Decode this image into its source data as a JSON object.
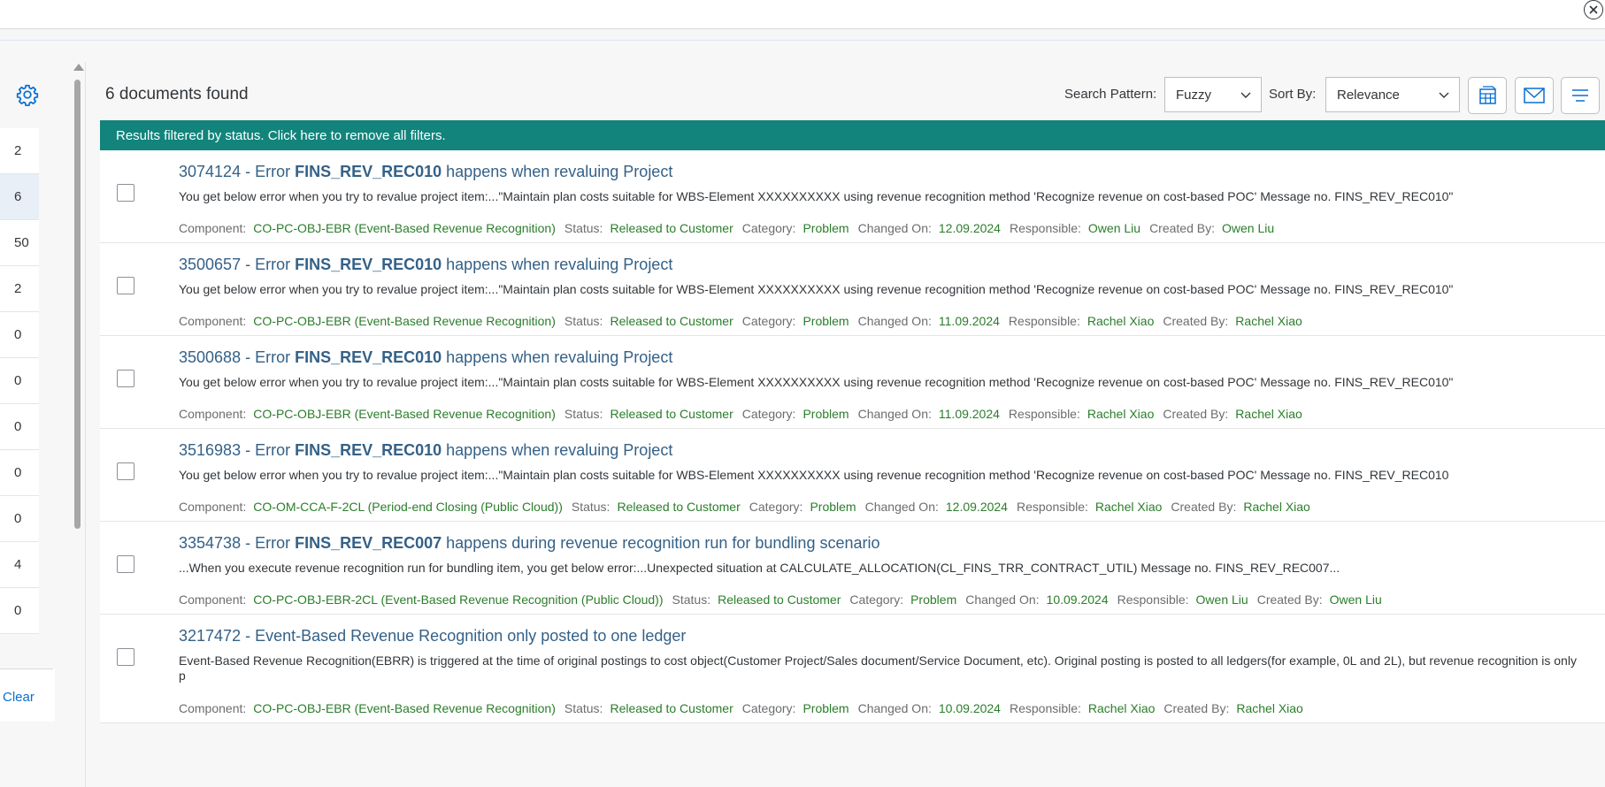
{
  "header": {
    "close_icon": "close-circle-icon"
  },
  "left_panel": {
    "settings_icon": "gear-icon",
    "counts": [
      "2",
      "6",
      "50",
      "2",
      "0",
      "0",
      "0",
      "0",
      "0",
      "4",
      "0"
    ],
    "active_index": 1,
    "clear_label": "Clear"
  },
  "toolbar": {
    "result_count": "6 documents found",
    "search_pattern_label": "Search Pattern:",
    "search_pattern_value": "Fuzzy",
    "sort_by_label": "Sort By:",
    "sort_by_value": "Relevance",
    "export_icon": "spreadsheet-export-icon",
    "email_icon": "envelope-icon",
    "settings_icon": "view-settings-icon"
  },
  "filter_bar": {
    "text": "Results filtered by status. Click here to remove all filters."
  },
  "meta_labels": {
    "component": "Component:",
    "status": "Status:",
    "category": "Category:",
    "changed_on": "Changed On:",
    "responsible": "Responsible:",
    "created_by": "Created By:"
  },
  "results": [
    {
      "title_prefix": "3074124 - Error ",
      "title_bold": "FINS_REV_REC010",
      "title_suffix": " happens when revaluing Project",
      "description": "You get below error when you try to revalue project item:...\"Maintain plan costs suitable for WBS-Element XXXXXXXXXX using revenue recognition method 'Recognize revenue on cost-based POC' Message no. FINS_REV_REC010\"",
      "component": "CO-PC-OBJ-EBR (Event-Based Revenue Recognition)",
      "status": "Released to Customer",
      "category": "Problem",
      "changed_on": "12.09.2024",
      "responsible": "Owen Liu",
      "created_by": "Owen Liu"
    },
    {
      "title_prefix": "3500657 - Error ",
      "title_bold": "FINS_REV_REC010",
      "title_suffix": " happens when revaluing Project",
      "description": "You get below error when you try to revalue project item:...\"Maintain plan costs suitable for WBS-Element XXXXXXXXXX using revenue recognition method 'Recognize revenue on cost-based POC' Message no. FINS_REV_REC010\"",
      "component": "CO-PC-OBJ-EBR (Event-Based Revenue Recognition)",
      "status": "Released to Customer",
      "category": "Problem",
      "changed_on": "11.09.2024",
      "responsible": "Rachel Xiao",
      "created_by": "Rachel Xiao"
    },
    {
      "title_prefix": "3500688 - Error ",
      "title_bold": "FINS_REV_REC010",
      "title_suffix": " happens when revaluing Project",
      "description": "You get below error when you try to revalue project item:...\"Maintain plan costs suitable for WBS-Element XXXXXXXXXX using revenue recognition method 'Recognize revenue on cost-based POC' Message no. FINS_REV_REC010\"",
      "component": "CO-PC-OBJ-EBR (Event-Based Revenue Recognition)",
      "status": "Released to Customer",
      "category": "Problem",
      "changed_on": "11.09.2024",
      "responsible": "Rachel Xiao",
      "created_by": "Rachel Xiao"
    },
    {
      "title_prefix": "3516983 - Error ",
      "title_bold": "FINS_REV_REC010",
      "title_suffix": " happens when revaluing Project",
      "description": "You get below error when you try to revalue project item:...\"Maintain plan costs suitable for WBS-Element XXXXXXXXXX using revenue recognition method 'Recognize revenue on cost-based POC' Message no. FINS_REV_REC010",
      "component": "CO-OM-CCA-F-2CL (Period-end Closing (Public Cloud))",
      "status": "Released to Customer",
      "category": "Problem",
      "changed_on": "12.09.2024",
      "responsible": "Rachel Xiao",
      "created_by": "Rachel Xiao"
    },
    {
      "title_prefix": "3354738 - Error ",
      "title_bold": "FINS_REV_REC007",
      "title_suffix": " happens during revenue recognition run for bundling scenario",
      "description": "...When you execute revenue recognition run for bundling item, you get below error:...Unexpected situation at CALCULATE_ALLOCATION(CL_FINS_TRR_CONTRACT_UTIL) Message no. FINS_REV_REC007...",
      "component": "CO-PC-OBJ-EBR-2CL (Event-Based Revenue Recognition (Public Cloud))",
      "status": "Released to Customer",
      "category": "Problem",
      "changed_on": "10.09.2024",
      "responsible": "Owen Liu",
      "created_by": "Owen Liu"
    },
    {
      "title_prefix": "3217472 - Event-Based Revenue Recognition only posted to one ledger",
      "title_bold": "",
      "title_suffix": "",
      "description": "Event-Based Revenue Recognition(EBRR) is triggered at the time of original postings to cost object(Customer Project/Sales document/Service Document, etc). Original posting is posted to all ledgers(for example, 0L and 2L), but revenue recognition is only p",
      "component": "CO-PC-OBJ-EBR (Event-Based Revenue Recognition)",
      "status": "Released to Customer",
      "category": "Problem",
      "changed_on": "10.09.2024",
      "responsible": "Rachel Xiao",
      "created_by": "Rachel Xiao"
    }
  ]
}
